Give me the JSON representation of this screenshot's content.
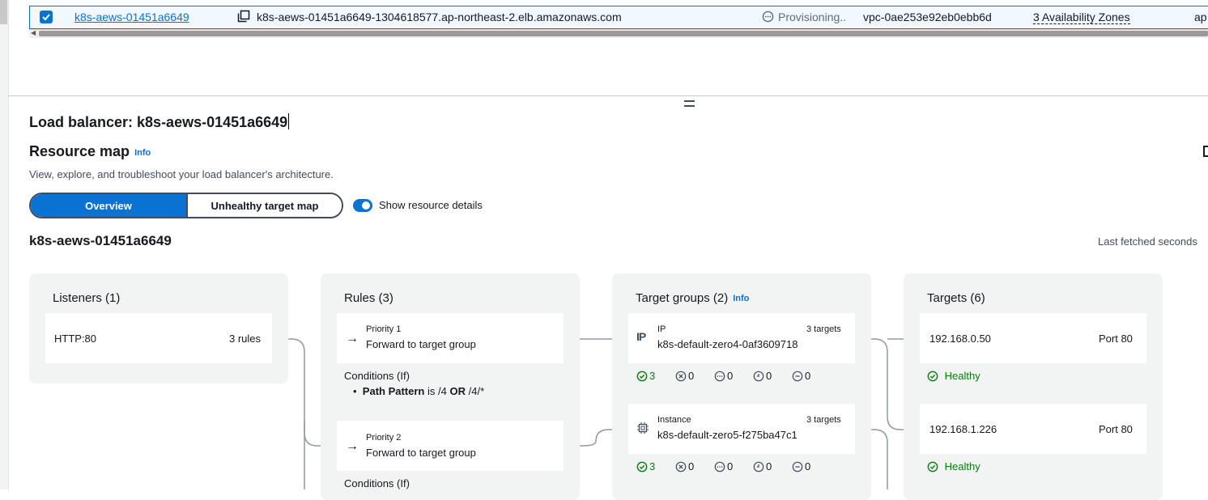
{
  "table_row": {
    "name": "k8s-aews-01451a6649",
    "dns_name": "k8s-aews-01451a6649-1304618577.ap-northeast-2.elb.amazonaws.com",
    "state": "Provisioning..",
    "vpc": "vpc-0ae253e92eb0ebb6d",
    "availability_zones": "3 Availability Zones",
    "truncated_tail": "ap"
  },
  "detail": {
    "heading": "Load balancer: k8s-aews-01451a6649",
    "section_title": "Resource map",
    "info_label": "Info",
    "description": "View, explore, and troubleshoot your load balancer's architecture.",
    "tabs": [
      "Overview",
      "Unhealthy target map"
    ],
    "toggle_label": "Show resource details",
    "lb_name": "k8s-aews-01451a6649",
    "last_fetched": "Last fetched seconds"
  },
  "resource_map": {
    "listeners": {
      "title": "Listeners (1)",
      "items": [
        {
          "protocol": "HTTP:80",
          "rules": "3 rules"
        }
      ]
    },
    "rules": {
      "title": "Rules (3)",
      "items": [
        {
          "priority": "Priority 1",
          "action": "Forward to target group"
        },
        {
          "priority": "Priority 2",
          "action": "Forward to target group"
        }
      ],
      "conditions_label": "Conditions (If)",
      "condition1": {
        "key": "Path Pattern",
        "is": "is",
        "v1": "/4",
        "op": "OR",
        "v2": "/4/*"
      }
    },
    "target_groups": {
      "title": "Target groups (2)",
      "info": "Info",
      "items": [
        {
          "type": "IP",
          "count": "3 targets",
          "name": "k8s-default-zero4-0af3609718",
          "stats": {
            "healthy": "3",
            "unhealthy": "0",
            "unused": "0",
            "initial": "0",
            "draining": "0"
          }
        },
        {
          "type": "Instance",
          "count": "3 targets",
          "name": "k8s-default-zero5-f275ba47c1",
          "stats": {
            "healthy": "3",
            "unhealthy": "0",
            "unused": "0",
            "initial": "0",
            "draining": "0"
          }
        }
      ]
    },
    "targets": {
      "title": "Targets (6)",
      "items": [
        {
          "ip": "192.168.0.50",
          "port": "Port 80",
          "status": "Healthy"
        },
        {
          "ip": "192.168.1.226",
          "port": "Port 80",
          "status": "Healthy"
        }
      ]
    }
  },
  "colors": {
    "accent": "#0972d3",
    "healthy": "#037f0c",
    "panel": "#f2f3f3"
  }
}
